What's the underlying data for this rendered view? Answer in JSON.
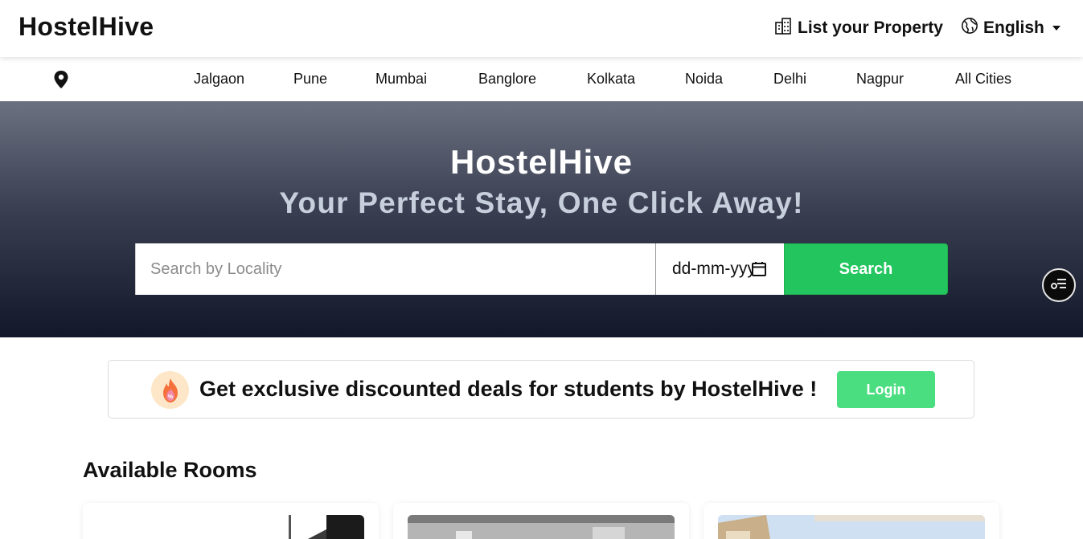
{
  "header": {
    "logo": "HostelHive",
    "list_property": "List your Property",
    "language": "English"
  },
  "cities": [
    "Jalgaon",
    "Pune",
    "Mumbai",
    "Banglore",
    "Kolkata",
    "Noida",
    "Delhi",
    "Nagpur",
    "All Cities"
  ],
  "hero": {
    "title": "HostelHive",
    "subtitle": "Your Perfect Stay, One Click Away!",
    "search_placeholder": "Search by Locality",
    "date_placeholder": "dd-mm-yyyy",
    "search_button": "Search"
  },
  "deals": {
    "text": "Get exclusive discounted deals for students by HostelHive !",
    "login_button": "Login"
  },
  "rooms": {
    "title": "Available Rooms"
  },
  "colors": {
    "accent": "#22c55e",
    "login": "#4ade80",
    "hero_top": "#6b7180",
    "hero_bottom": "#121829"
  }
}
